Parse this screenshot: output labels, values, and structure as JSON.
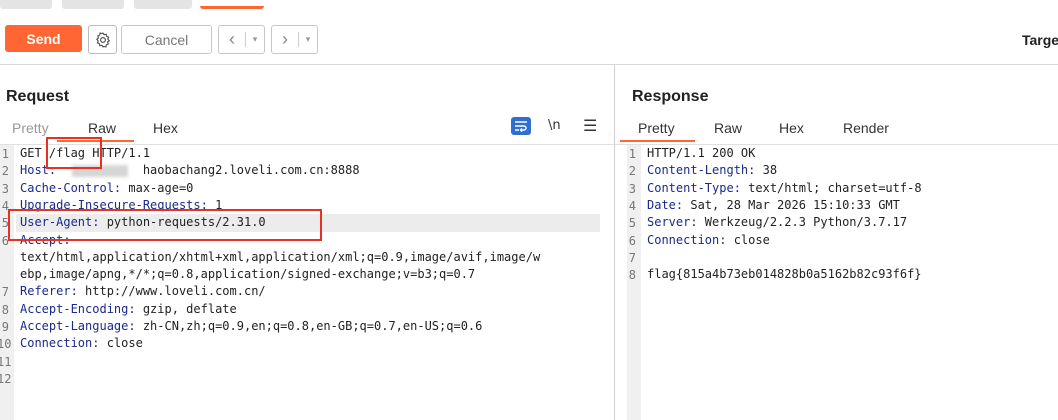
{
  "toolbar": {
    "send_label": "Send",
    "cancel_label": "Cancel",
    "target_label": "Targe"
  },
  "request": {
    "title": "Request",
    "tabs": [
      "Pretty",
      "Raw",
      "Hex"
    ],
    "active_tab": "Raw",
    "newline_toggle": "\\n",
    "lines": [
      {
        "n": "1",
        "key": "GET",
        "val": " /flag HTTP/1.1",
        "plain": true
      },
      {
        "n": "2",
        "key": "Host:",
        "val": "            haobachang2.loveli.com.cn:8888"
      },
      {
        "n": "3",
        "key": "Cache-Control:",
        "val": " max-age=0"
      },
      {
        "n": "4",
        "key": "Upgrade-Insecure-Requests:",
        "val": " 1"
      },
      {
        "n": "5",
        "key": "User-Agent:",
        "val": " python-requests/2.31.0"
      },
      {
        "n": "6",
        "key": "Accept:",
        "val": ""
      },
      {
        "n": "",
        "key": "",
        "val": "text/html,application/xhtml+xml,application/xml;q=0.9,image/avif,image/w"
      },
      {
        "n": "",
        "key": "",
        "val": "ebp,image/apng,*/*;q=0.8,application/signed-exchange;v=b3;q=0.7"
      },
      {
        "n": "7",
        "key": "Referer:",
        "val": " http://www.loveli.com.cn/"
      },
      {
        "n": "8",
        "key": "Accept-Encoding:",
        "val": " gzip, deflate"
      },
      {
        "n": "9",
        "key": "Accept-Language:",
        "val": " zh-CN,zh;q=0.9,en;q=0.8,en-GB;q=0.7,en-US;q=0.6"
      },
      {
        "n": "10",
        "key": "Connection:",
        "val": " close"
      },
      {
        "n": "11",
        "key": "",
        "val": ""
      },
      {
        "n": "12",
        "key": "",
        "val": ""
      }
    ]
  },
  "response": {
    "title": "Response",
    "tabs": [
      "Pretty",
      "Raw",
      "Hex",
      "Render"
    ],
    "active_tab": "Pretty",
    "lines": [
      {
        "n": "1",
        "key": "HTTP/1.1 200 OK",
        "val": "",
        "plain": true
      },
      {
        "n": "2",
        "key": "Content-Length:",
        "val": " 38"
      },
      {
        "n": "3",
        "key": "Content-Type:",
        "val": " text/html; charset=utf-8"
      },
      {
        "n": "4",
        "key": "Date:",
        "val": " Sat, 28 Mar 2026 15:10:33 GMT"
      },
      {
        "n": "5",
        "key": "Server:",
        "val": " Werkzeug/2.2.3 Python/3.7.17"
      },
      {
        "n": "6",
        "key": "Connection:",
        "val": " close"
      },
      {
        "n": "7",
        "key": "",
        "val": ""
      },
      {
        "n": "8",
        "key": "flag{815a4b73eb014828b0a5162b82c93f6f}",
        "val": "",
        "plain": true
      }
    ]
  },
  "colors": {
    "accent": "#ff6633",
    "header_key": "#1a2a8a",
    "annotation_red": "#e53222"
  }
}
